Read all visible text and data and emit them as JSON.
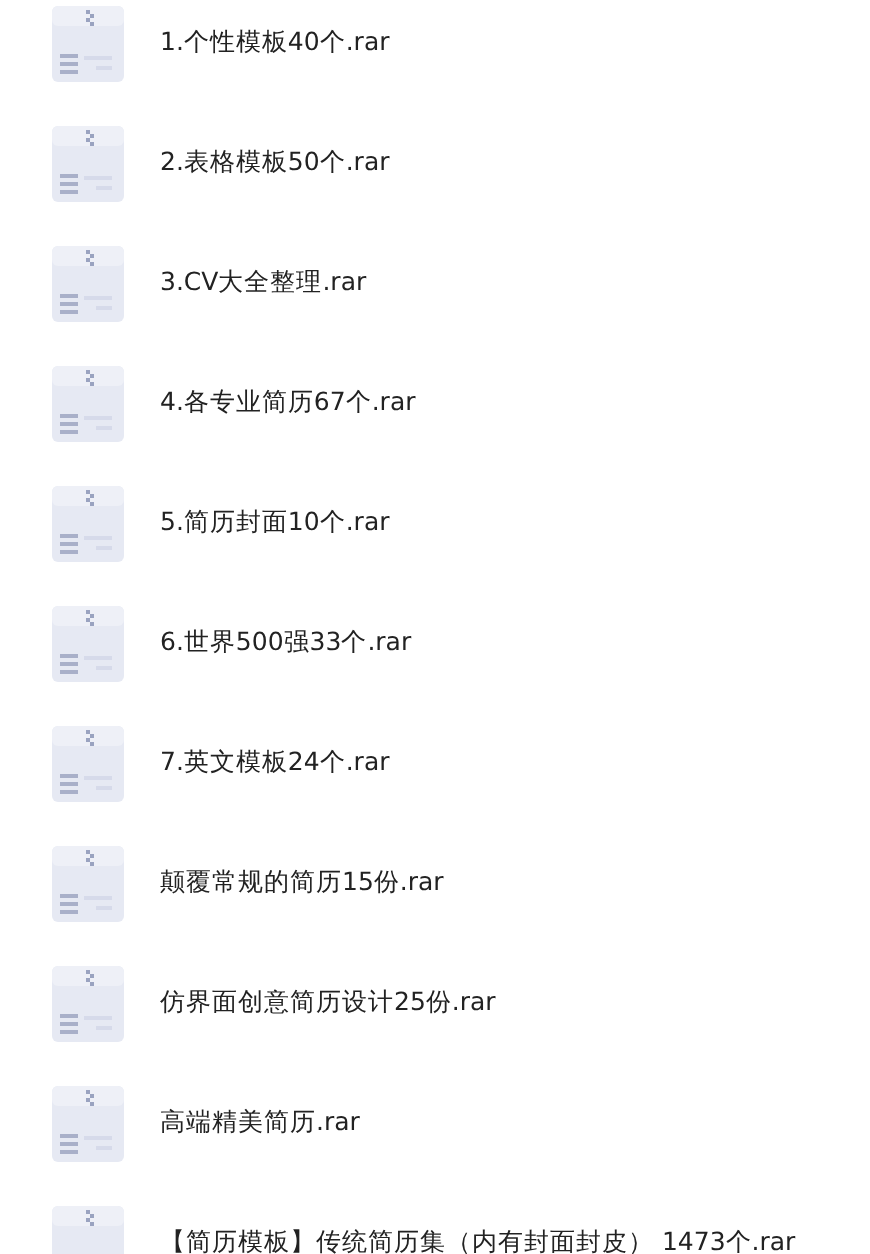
{
  "files": [
    {
      "name": "1.个性模板40个.rar"
    },
    {
      "name": "2.表格模板50个.rar"
    },
    {
      "name": "3.CV大全整理.rar"
    },
    {
      "name": "4.各专业简历67个.rar"
    },
    {
      "name": "5.简历封面10个.rar"
    },
    {
      "name": "6.世界500强33个.rar"
    },
    {
      "name": "7.英文模板24个.rar"
    },
    {
      "name": "颠覆常规的简历15份.rar"
    },
    {
      "name": "仿界面创意简历设计25份.rar"
    },
    {
      "name": "高端精美简历.rar"
    },
    {
      "name": "【简历模板】传统简历集（内有封面封皮） 1473个.rar"
    }
  ]
}
